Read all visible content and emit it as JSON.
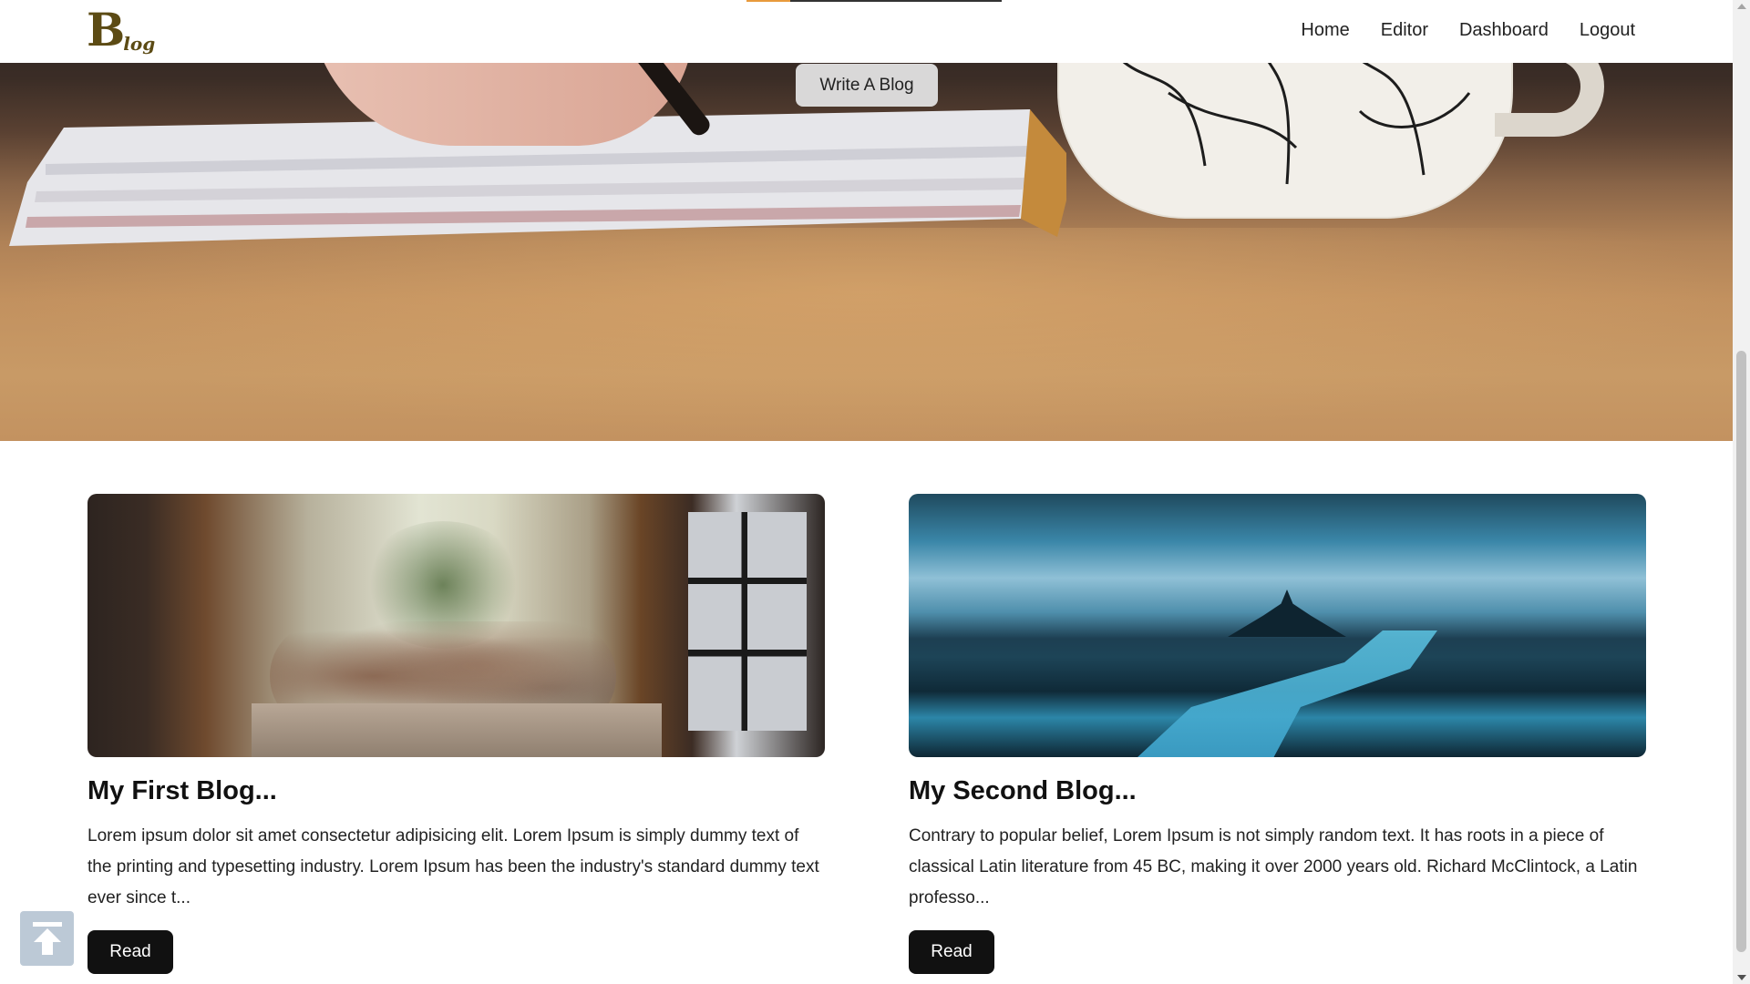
{
  "navbar": {
    "logo_big": "B",
    "logo_small": "log",
    "links": [
      "Home",
      "Editor",
      "Dashboard",
      "Logout"
    ]
  },
  "reading_progress_percent": 17,
  "hero": {
    "write_button": "Write A Blog"
  },
  "posts": [
    {
      "title": "My First Blog...",
      "excerpt": "Lorem ipsum dolor sit amet consectetur adipisicing elit. Lorem Ipsum is simply dummy text of the printing and typesetting industry. Lorem Ipsum has been the industry's standard dummy text ever since t...",
      "button": "Read"
    },
    {
      "title": "My Second Blog...",
      "excerpt": "Contrary to popular belief, Lorem Ipsum is not simply random text. It has roots in a piece of classical Latin literature from 45 BC, making it over 2000 years old. Richard McClintock, a Latin professo...",
      "button": "Read"
    }
  ],
  "colors": {
    "logo": "#5c4b14",
    "progress": "#e89a3c",
    "button_dark": "#111111"
  },
  "icons": {
    "back_to_top": "arrow-up-to-line-icon"
  }
}
